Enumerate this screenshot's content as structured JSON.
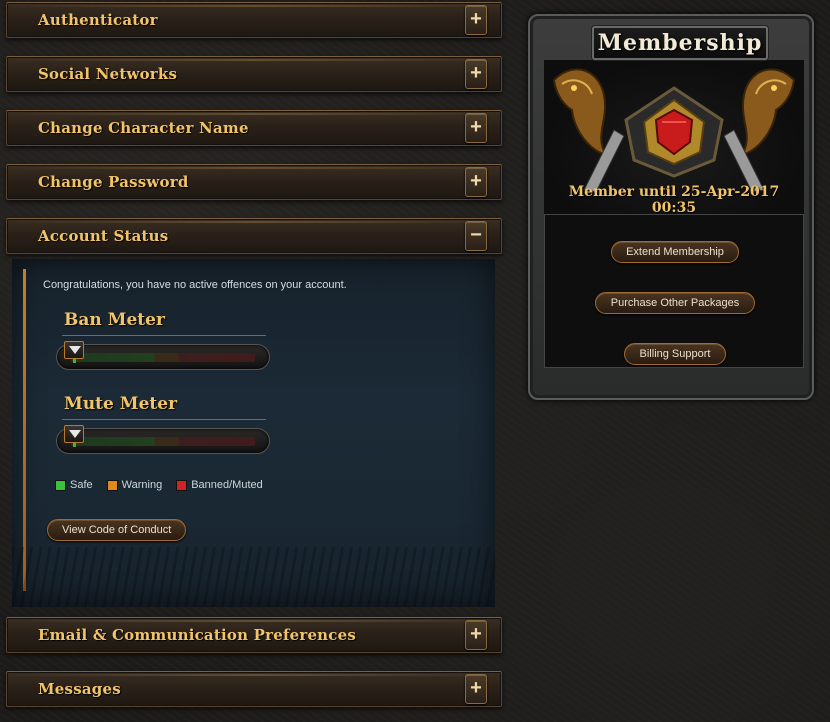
{
  "sections": [
    {
      "label": "Authenticator",
      "toggle": "+"
    },
    {
      "label": "Social Networks",
      "toggle": "+"
    },
    {
      "label": "Change Character Name",
      "toggle": "+"
    },
    {
      "label": "Change Password",
      "toggle": "+"
    },
    {
      "label": "Account Status",
      "toggle": "−"
    },
    {
      "label": "Email & Communication Preferences",
      "toggle": "+"
    },
    {
      "label": "Messages",
      "toggle": "+"
    }
  ],
  "account_status": {
    "message": "Congratulations, you have no active offences on your account.",
    "ban_meter": {
      "title": "Ban Meter",
      "level": 0
    },
    "mute_meter": {
      "title": "Mute Meter",
      "level": 0
    },
    "legend": [
      {
        "label": "Safe",
        "color": "#3cc23a"
      },
      {
        "label": "Warning",
        "color": "#e08a1e"
      },
      {
        "label": "Banned/Muted",
        "color": "#d02424"
      }
    ],
    "code_of_conduct_button": "View Code of Conduct"
  },
  "membership": {
    "title": "Membership",
    "member_until": "Member until 25-Apr-2017 00:35",
    "buttons": {
      "extend": "Extend Membership",
      "purchase": "Purchase Other Packages",
      "billing": "Billing Support"
    }
  }
}
